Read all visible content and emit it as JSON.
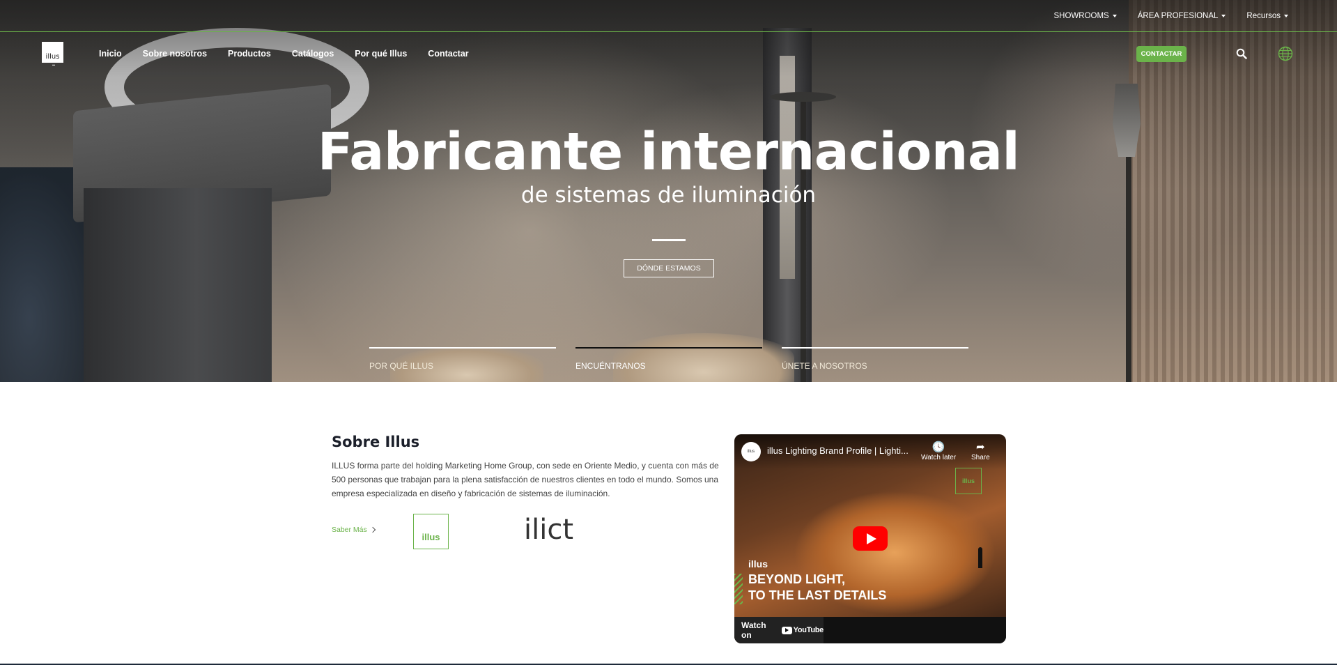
{
  "topbar": {
    "items": [
      {
        "label": "SHOWROOMS"
      },
      {
        "label": "ÁREA PROFESIONAL"
      },
      {
        "label": "Recursos"
      }
    ]
  },
  "nav": {
    "logo_text": "illus",
    "links": [
      "Inicio",
      "Sobre nosotros",
      "Productos",
      "Catálogos",
      "Por qué Illus",
      "Contactar"
    ],
    "contact_button": "CONTACTAR"
  },
  "hero": {
    "title": "Fabricante internacional",
    "subtitle": "de sistemas de iluminación",
    "cta": "DÓNDE ESTAMOS",
    "tabs": [
      "POR QUÉ ILLUS",
      "ENCUÉNTRANOS",
      "ÚNETE A NOSOTROS"
    ],
    "active_tab": 1
  },
  "about": {
    "heading": "Sobre Illus",
    "body": "ILLUS forma parte del holding Marketing Home Group, con sede en Oriente Medio, y cuenta con más de 500 personas que trabajan para la plena satisfacción de nuestros clientes en todo el mundo. Somos una empresa especializada en diseño y fabricación de sistemas de iluminación.",
    "link": "Saber Más",
    "brand_logos": [
      "illus",
      "ilict"
    ]
  },
  "video": {
    "channel_badge": "illus",
    "title": "illus Lighting Brand Profile | Lighti...",
    "watch_later": "Watch later",
    "share": "Share",
    "overlay_brand": "illus",
    "overlay_line1": "BEYOND LIGHT,",
    "overlay_line2": "TO THE LAST DETAILS",
    "corner_badge": "illus",
    "watch_on": "Watch on",
    "platform": "YouTube"
  },
  "colors": {
    "accent": "#6bb34a"
  }
}
